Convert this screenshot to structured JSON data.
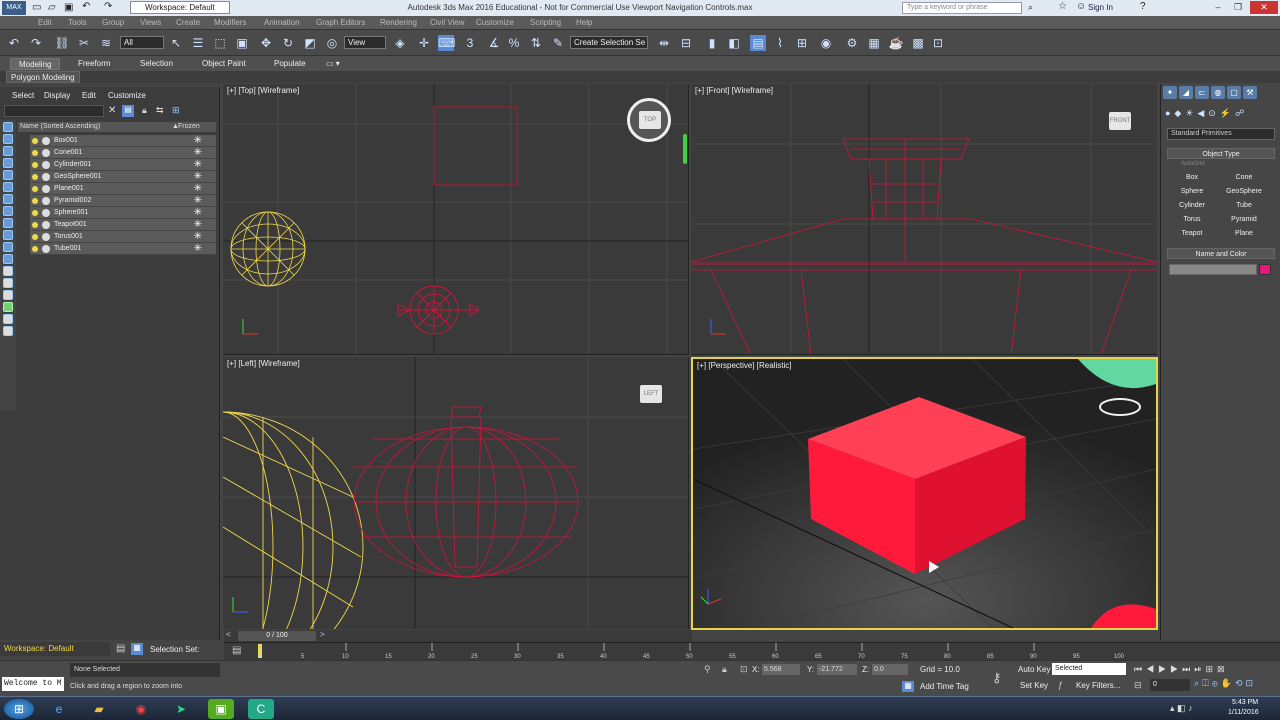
{
  "titlebar": {
    "workspace": "Workspace: Default",
    "title": "Autodesk 3ds Max 2016 Educational - Not for Commercial Use   Viewport Navigation Controls.max",
    "search_placeholder": "Type a keyword or phrase",
    "signin": "Sign In"
  },
  "menubar": {
    "items": [
      "Edit",
      "Tools",
      "Group",
      "Views",
      "Create",
      "Modifiers",
      "Animation",
      "Graph Editors",
      "Rendering",
      "Civil View",
      "Customize",
      "Scripting",
      "Help"
    ]
  },
  "toolbar": {
    "filter_value": "All",
    "refcoord_value": "View",
    "selection_set": "Create Selection Se"
  },
  "ribbon": {
    "tabs": [
      "Modeling",
      "Freeform",
      "Selection",
      "Object Paint",
      "Populate"
    ],
    "sub": "Polygon Modeling"
  },
  "scene_explorer": {
    "menus": [
      "Select",
      "Display",
      "Edit",
      "Customize"
    ],
    "col_name": "Name (Sorted Ascending)",
    "col_frozen": "Frozen",
    "objects": [
      "Box001",
      "Cone001",
      "Cylinder001",
      "GeoSphere001",
      "Plane001",
      "Pyramid002",
      "Sphere001",
      "Teapot001",
      "Torus001",
      "Tube001"
    ]
  },
  "viewports": {
    "top": "[+] [Top] [Wireframe]",
    "front": "[+] [Front] [Wireframe]",
    "left": "[+] [Left] [Wireframe]",
    "perspective": "[+] [Perspective] [Realistic]",
    "cube_top": "TOP",
    "cube_front": "FRONT",
    "cube_left": "LEFT"
  },
  "command_panel": {
    "dropdown": "Standard Primitives",
    "rollout_object_type": "Object Type",
    "autogrid": "AutoGrid",
    "primitives": [
      "Box",
      "Cone",
      "Sphere",
      "GeoSphere",
      "Cylinder",
      "Tube",
      "Torus",
      "Pyramid",
      "Teapot",
      "Plane"
    ],
    "rollout_name_color": "Name and Color",
    "swatch_color": "#e0197a"
  },
  "timeline": {
    "frame": "0 / 100",
    "ticks": [
      "0",
      "5",
      "10",
      "15",
      "20",
      "25",
      "30",
      "35",
      "40",
      "45",
      "50",
      "55",
      "60",
      "65",
      "70",
      "75",
      "80",
      "85",
      "90",
      "95",
      "100"
    ]
  },
  "status": {
    "workspace": "Workspace: Default",
    "selection_set": "Selection Set:",
    "none_selected": "None Selected",
    "prompt": "Click and drag a region to zoom into",
    "welcome": "Welcome to M",
    "x_label": "X:",
    "x_value": "5.568",
    "y_label": "Y:",
    "y_value": "-21.772",
    "z_label": "Z:",
    "z_value": "0.0",
    "grid": "Grid = 10.0",
    "add_time_tag": "Add Time Tag",
    "auto_key": "Auto Key",
    "selected": "Selected",
    "set_key": "Set Key",
    "key_filters": "Key Filters...",
    "frame_field": "0"
  },
  "taskbar": {
    "time": "5:43 PM",
    "date": "1/11/2016"
  },
  "colors": {
    "wire_red": "#d0143c",
    "wire_yellow": "#f0d84a",
    "box_red": "#ff1a3c",
    "viewport_border": "#e8d44a"
  }
}
